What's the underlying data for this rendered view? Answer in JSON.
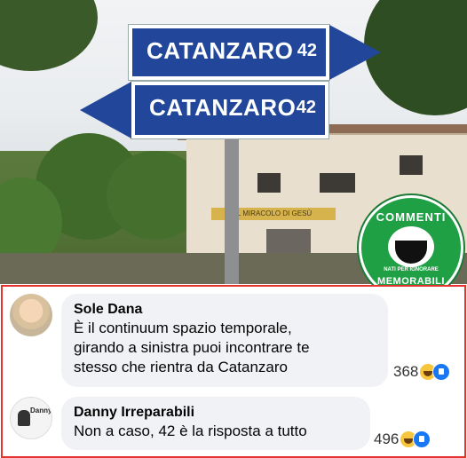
{
  "photo": {
    "sign_top": {
      "place": "CATANZARO",
      "distance": "42"
    },
    "sign_bottom": {
      "place": "CATANZARO",
      "distance": "42"
    },
    "shop_sign": "IL MIRACOLO DI GESÙ",
    "badge": {
      "top": "COMMENTI",
      "middle": "NATI PER IGNORARE",
      "bottom": "MEMORABILI"
    }
  },
  "comments": [
    {
      "author": "Sole Dana",
      "lines": [
        "È il continuum spazio temporale,",
        "girando a sinistra puoi incontrare te",
        "stesso che rientra da Catanzaro"
      ],
      "reaction_count": "368",
      "reactions": [
        "haha-icon",
        "like-icon"
      ]
    },
    {
      "author": "Danny Irreparabili",
      "avatar_label": "Danny",
      "lines": [
        "Non a caso, 42 è la risposta a tutto"
      ],
      "reaction_count": "496",
      "reactions": [
        "haha-icon",
        "like-icon"
      ]
    }
  ],
  "colors": {
    "frame": "#e5322d",
    "bubble": "#f0f2f5",
    "sign": "#22479a",
    "badge": "#1fa045"
  }
}
